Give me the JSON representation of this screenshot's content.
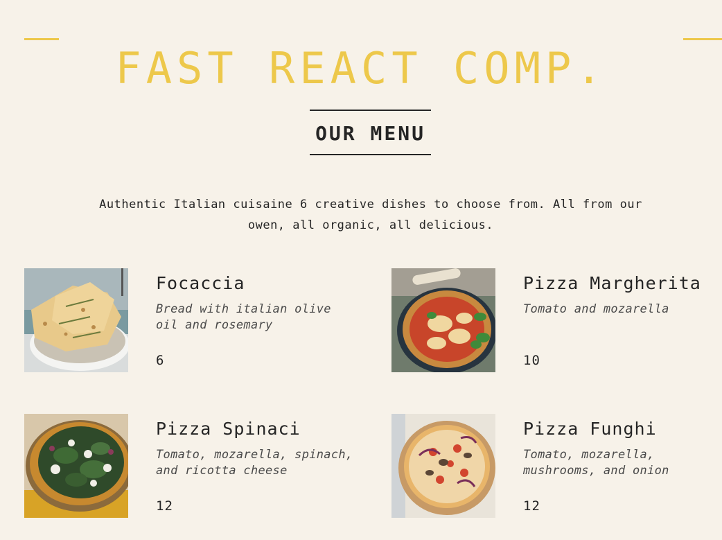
{
  "header": {
    "title": "FAST REACT COMP."
  },
  "menu": {
    "heading": "OUR MENU",
    "intro": "Authentic Italian cuisaine 6 creative dishes to choose from. All from our owen, all organic, all delicious.",
    "pizzas": [
      {
        "name": "Focaccia",
        "ingredients": "Bread with italian olive oil and rosemary",
        "price": "6",
        "photo_icon": "focaccia-photo"
      },
      {
        "name": "Pizza Margherita",
        "ingredients": "Tomato and mozarella",
        "price": "10",
        "photo_icon": "pizza-margherita-photo"
      },
      {
        "name": "Pizza Spinaci",
        "ingredients": "Tomato, mozarella, spinach, and ricotta cheese",
        "price": "12",
        "photo_icon": "pizza-spinaci-photo"
      },
      {
        "name": "Pizza Funghi",
        "ingredients": "Tomato, mozarella, mushrooms, and onion",
        "price": "12",
        "photo_icon": "pizza-funghi-photo"
      }
    ]
  },
  "colors": {
    "background": "#f7f2e9",
    "accent": "#edc84b",
    "text": "#252525"
  }
}
